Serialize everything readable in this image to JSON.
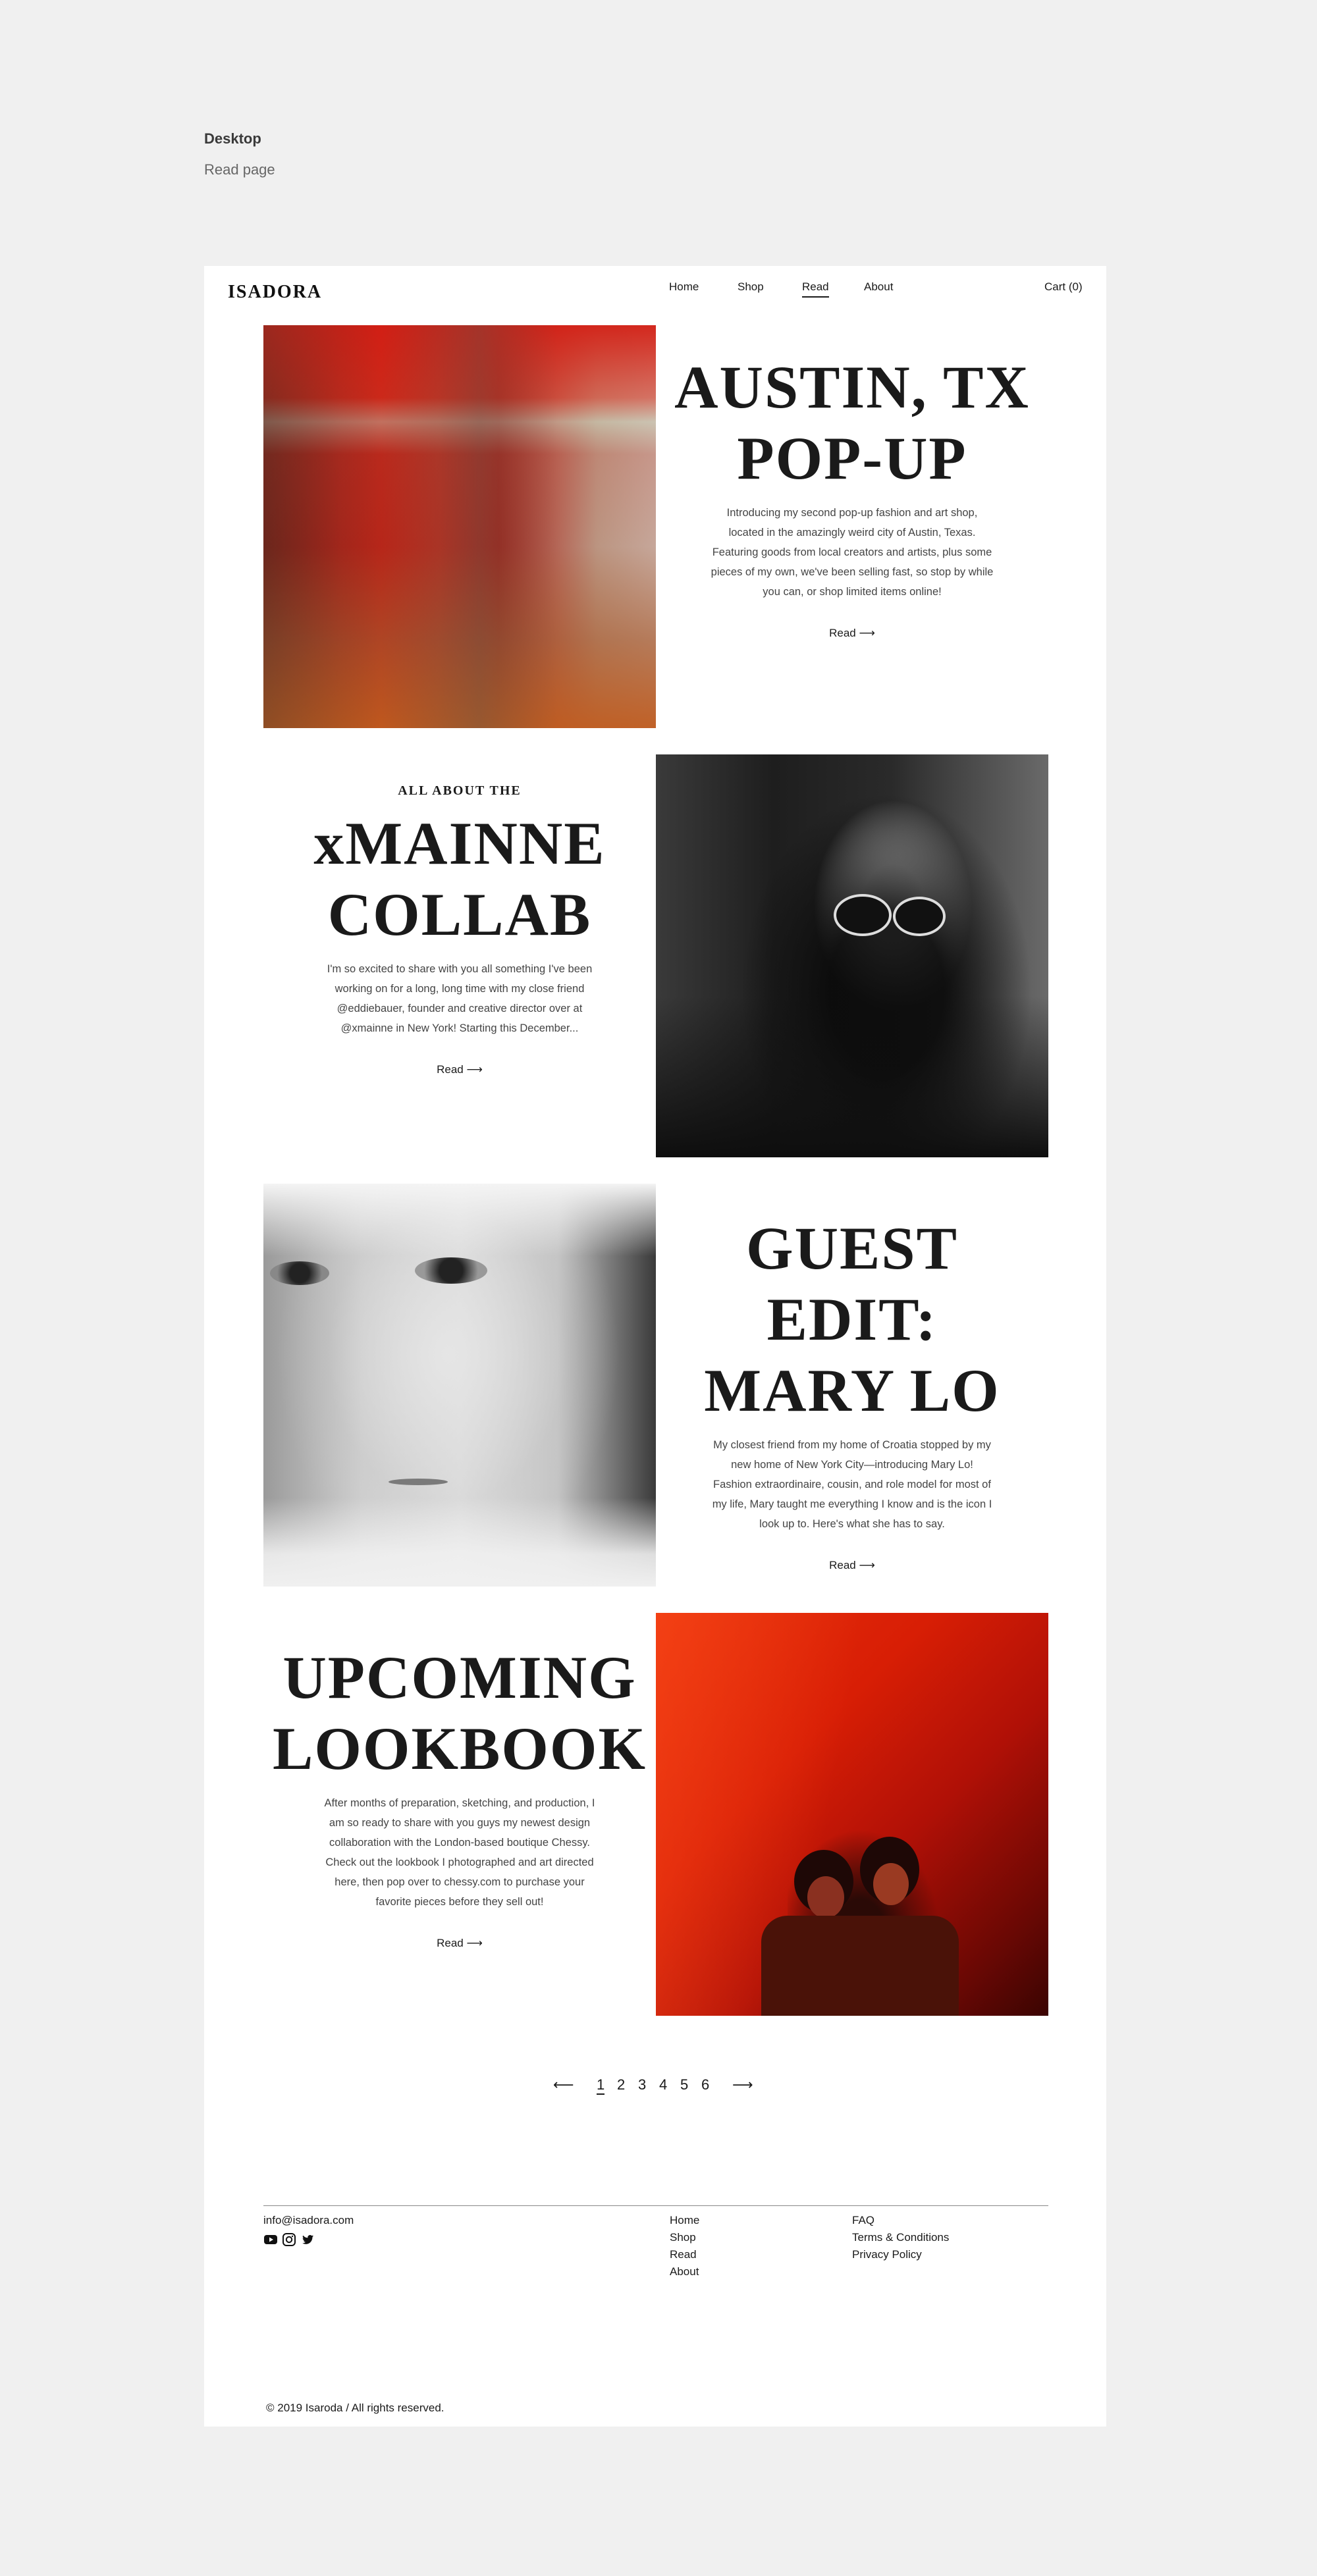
{
  "meta": {
    "title": "Desktop",
    "subtitle": "Read page"
  },
  "header": {
    "logo": "ISADORA",
    "nav": [
      "Home",
      "Shop",
      "Read",
      "About"
    ],
    "active_nav": "Read",
    "cart": "Cart (0)"
  },
  "articles": [
    {
      "kicker": "",
      "headline": [
        "AUSTIN, TX",
        "POP-UP"
      ],
      "body": "Introducing my second pop-up fashion and art shop, located in the amazingly weird city of Austin, Texas. Featuring goods from local creators and artists, plus some pieces of my own, we've been selling fast, so stop by while you can, or shop limited items online!",
      "read": "Read ⟶",
      "image": "blurred-red-interior"
    },
    {
      "kicker": "ALL ABOUT THE",
      "headline": [
        "xMAINNE",
        "COLLAB"
      ],
      "body": "I'm so excited to share with you all something I've been working on for a long, long time with my close friend @eddiebauer, founder and creative director over at @xmainne in New York! Starting this December...",
      "read": "Read ⟶",
      "image": "woman-sunglasses-bw"
    },
    {
      "kicker": "",
      "headline": [
        "GUEST EDIT:",
        "MARY LO"
      ],
      "body": "My closest friend from my home of Croatia stopped by my new home of New York City—introducing Mary Lo! Fashion extraordinaire, cousin, and role model for most of my life, Mary taught me everything I know and is the icon I look up to. Here's what she has to say.",
      "read": "Read ⟶",
      "image": "portrait-bw-closeup"
    },
    {
      "kicker": "",
      "headline": [
        "UPCOMING",
        "LOOKBOOK"
      ],
      "body": "After months of preparation, sketching, and production, I am so ready to share with you guys my newest design collaboration with  the London-based boutique Chessy. Check out the lookbook I photographed and art directed here, then pop over to chessy.com to purchase your favorite pieces before they sell out!",
      "read": "Read ⟶",
      "image": "two-women-red-light"
    }
  ],
  "pagination": {
    "prev": "⟵",
    "pages": [
      "1",
      "2",
      "3",
      "4",
      "5",
      "6"
    ],
    "current": "1",
    "next": "⟶"
  },
  "footer": {
    "email": "info@isadora.com",
    "social": [
      "youtube-icon",
      "instagram-icon",
      "twitter-icon"
    ],
    "col1": [
      "Home",
      "Shop",
      "Read",
      "About"
    ],
    "col2": [
      "FAQ",
      "Terms & Conditions",
      "Privacy Policy"
    ],
    "copyright": "© 2019 Isaroda / All rights reserved."
  },
  "colors": {
    "background": "#f0f0f0",
    "page": "#ffffff",
    "text": "#1a1a1a",
    "accent_red": "#d81e05"
  }
}
